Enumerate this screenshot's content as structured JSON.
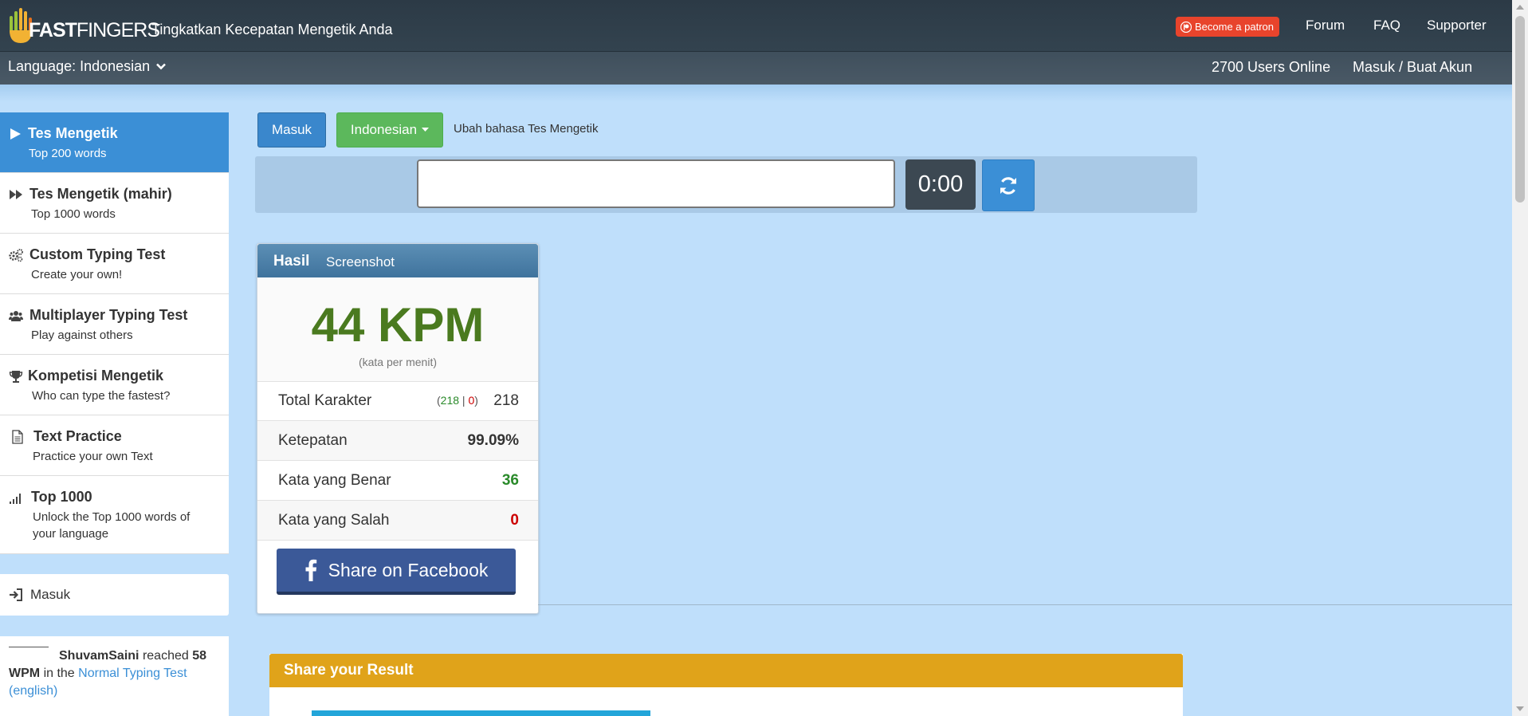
{
  "header": {
    "logo_text_bold": "FAST",
    "logo_text_light": "FINGERS",
    "tagline": "Tingkatkan Kecepatan Mengetik Anda",
    "patron_label": "Become a patron",
    "nav": [
      "Forum",
      "FAQ",
      "Supporter"
    ]
  },
  "subbar": {
    "language": "Language: Indonesian",
    "users_online": "2700 Users Online",
    "login": "Masuk / Buat Akun"
  },
  "sidebar": {
    "items": [
      {
        "title": "Tes Mengetik",
        "sub": "Top 200 words",
        "icon": "play-icon"
      },
      {
        "title": "Tes Mengetik (mahir)",
        "sub": "Top 1000 words",
        "icon": "fast-forward-icon"
      },
      {
        "title": "Custom Typing Test",
        "sub": "Create your own!",
        "icon": "gears-icon"
      },
      {
        "title": "Multiplayer Typing Test",
        "sub": "Play against others",
        "icon": "users-icon"
      },
      {
        "title": "Kompetisi Mengetik",
        "sub": "Who can type the fastest?",
        "icon": "trophy-icon"
      },
      {
        "title": "Text Practice",
        "sub": "Practice your own Text",
        "icon": "file-icon"
      },
      {
        "title": "Top 1000",
        "sub": "Unlock the Top 1000 words of your language",
        "icon": "signal-icon"
      }
    ],
    "login_label": "Masuk",
    "activity": {
      "user": "ShuvamSaini",
      "reached": "reached",
      "wpm": "58 WPM",
      "in_the": "in the",
      "test_link": "Normal Typing Test (english)"
    }
  },
  "controls": {
    "login_button": "Masuk",
    "language_button": "Indonesian",
    "change_language": "Ubah bahasa Tes Mengetik",
    "timer": "0:00",
    "input_value": ""
  },
  "result": {
    "tab_result": "Hasil",
    "tab_screenshot": "Screenshot",
    "wpm": "44 KPM",
    "wpm_label": "(kata per menit)",
    "keystrokes_label": "Total Karakter",
    "keystrokes_correct": "218",
    "keystrokes_wrong": "0",
    "keystrokes_total": "218",
    "accuracy_label": "Ketepatan",
    "accuracy": "99.09%",
    "correct_words_label": "Kata yang Benar",
    "correct_words": "36",
    "wrong_words_label": "Kata yang Salah",
    "wrong_words": "0",
    "facebook_button": "Share on Facebook"
  },
  "share": {
    "title": "Share your Result"
  },
  "colors": {
    "accent_blue": "#3b8fd6",
    "green_button": "#5cb85c",
    "wpm_green": "#4a7a1f",
    "error_red": "#cc0000",
    "facebook_blue": "#3b5998",
    "share_header": "#e0a31a",
    "patron_red": "#e8442c"
  }
}
